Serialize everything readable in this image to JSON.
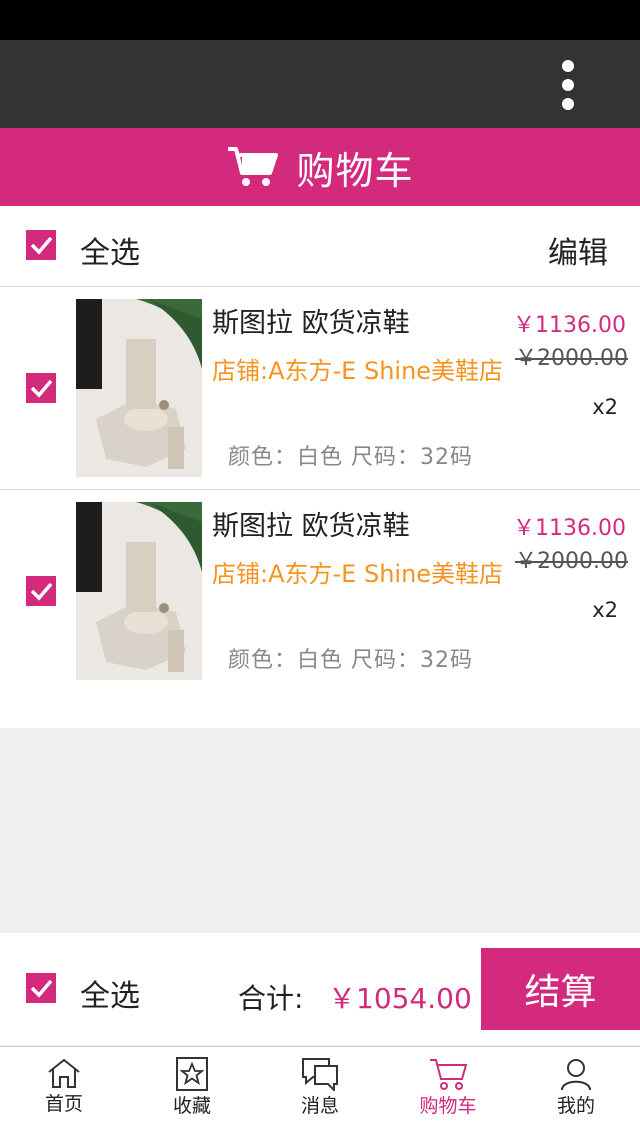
{
  "header": {
    "title": "购物车"
  },
  "select_bar": {
    "select_all_label": "全选",
    "edit_label": "编辑"
  },
  "items": [
    {
      "name": "斯图拉 欧货凉鞋",
      "shop": "店铺:A东方-E Shine美鞋店",
      "price": "￥1136.00",
      "original_price": "￥2000.00",
      "quantity": "x2",
      "spec": "颜色：白色 尺码：32码",
      "checked": true
    },
    {
      "name": "斯图拉 欧货凉鞋",
      "shop": "店铺:A东方-E Shine美鞋店",
      "price": "￥1136.00",
      "original_price": "￥2000.00",
      "quantity": "x2",
      "spec": "颜色：白色 尺码：32码",
      "checked": true
    }
  ],
  "checkout": {
    "select_all_label": "全选",
    "total_label": "合计:",
    "total_value": "￥1054.00",
    "button_label": "结算"
  },
  "tabs": [
    {
      "label": "首页",
      "icon": "home-icon"
    },
    {
      "label": "收藏",
      "icon": "star-icon"
    },
    {
      "label": "消息",
      "icon": "chat-icon"
    },
    {
      "label": "购物车",
      "icon": "cart-icon",
      "active": true
    },
    {
      "label": "我的",
      "icon": "user-icon"
    }
  ],
  "colors": {
    "accent": "#d42a7e",
    "shop_text": "#f7931e",
    "app_bar": "#333333",
    "status_bar": "#000000"
  }
}
